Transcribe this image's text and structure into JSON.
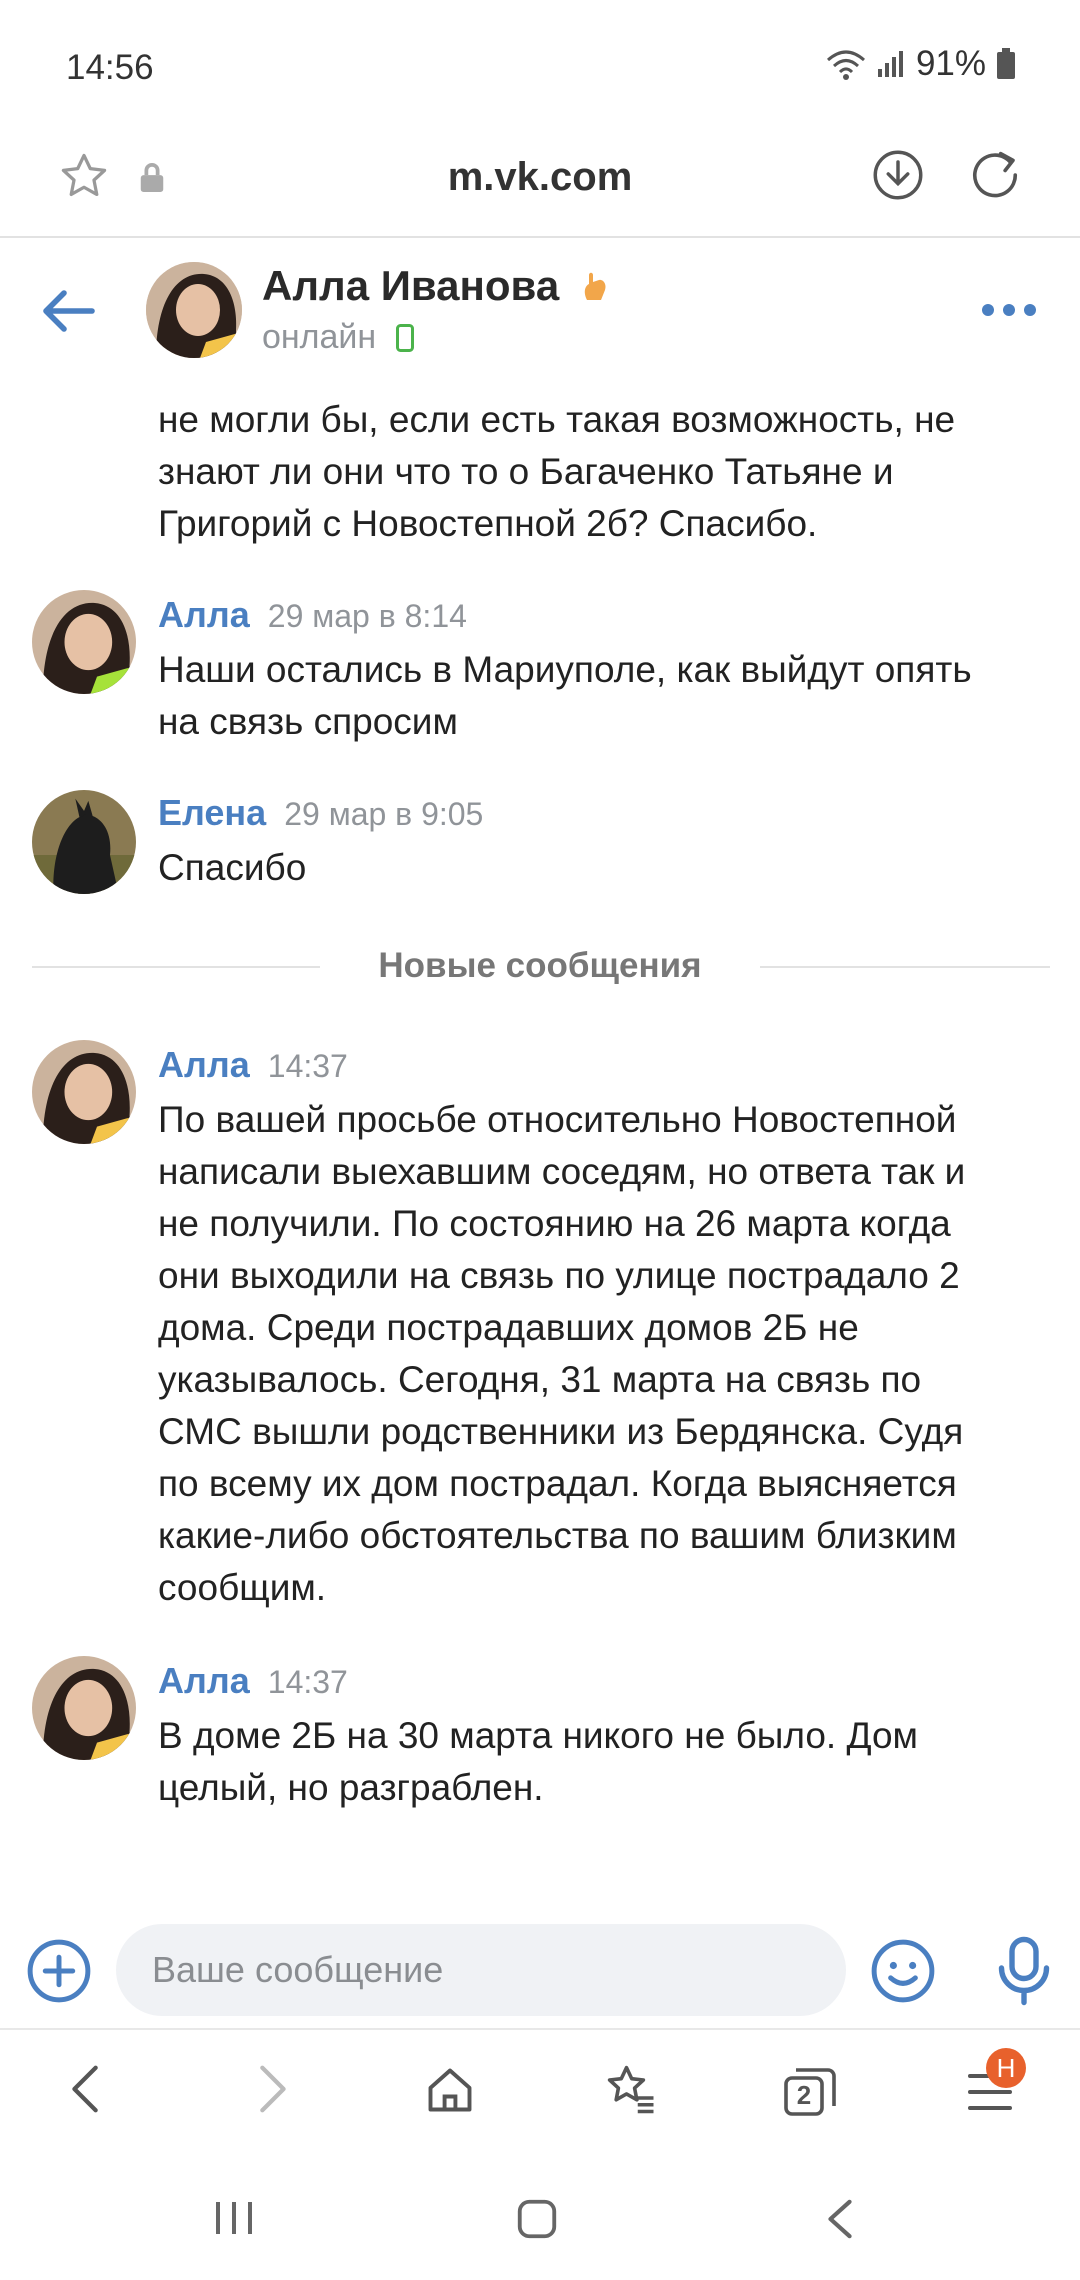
{
  "status_bar": {
    "time": "14:56",
    "battery": "91%"
  },
  "browser": {
    "url": "m.vk.com",
    "tabs_count": "2",
    "menu_badge": "Н"
  },
  "chat_header": {
    "name": "Алла Иванова",
    "status": "онлайн"
  },
  "partial_message": {
    "lines": [
      "не могли бы, если есть такая возможность, не",
      "знают ли они что то о Багаченко Татьяне и",
      "Григорий с Новостепной 2б? Спасибо."
    ]
  },
  "messages": [
    {
      "author": "Алла",
      "time": "29 мар в 8:14",
      "lines": [
        "Наши остались в Мариуполе, как выйдут опять",
        "на связь спросим"
      ]
    },
    {
      "author": "Елена",
      "time": "29 мар в 9:05",
      "lines": [
        "Спасибо"
      ]
    },
    {
      "author": "Алла",
      "time": "14:37",
      "lines": [
        "По вашей просьбе относительно Новостепной",
        "написали выехавшим соседям, но ответа так и",
        "не получили. По состоянию на 26 марта когда",
        "они выходили на связь по улице пострадало 2",
        "дома. Среди пострадавших домов 2Б не",
        "указывалось. Сегодня, 31 марта на связь по",
        "СМС вышли родственники из Бердянска. Судя",
        "по всему их дом пострадал. Когда выясняется",
        "какие-либо обстоятельства по вашим близким",
        "сообщим."
      ]
    },
    {
      "author": "Алла",
      "time": "14:37",
      "lines": [
        "В доме 2Б на 30 марта никого не было. Дом",
        "целый, но разграблен."
      ]
    }
  ],
  "divider": {
    "label": "Новые сообщения"
  },
  "composer": {
    "placeholder": "Ваше сообщение"
  },
  "colors": {
    "accent": "#4a7fc1",
    "online": "#4bb34b",
    "badge": "#e8612c"
  }
}
